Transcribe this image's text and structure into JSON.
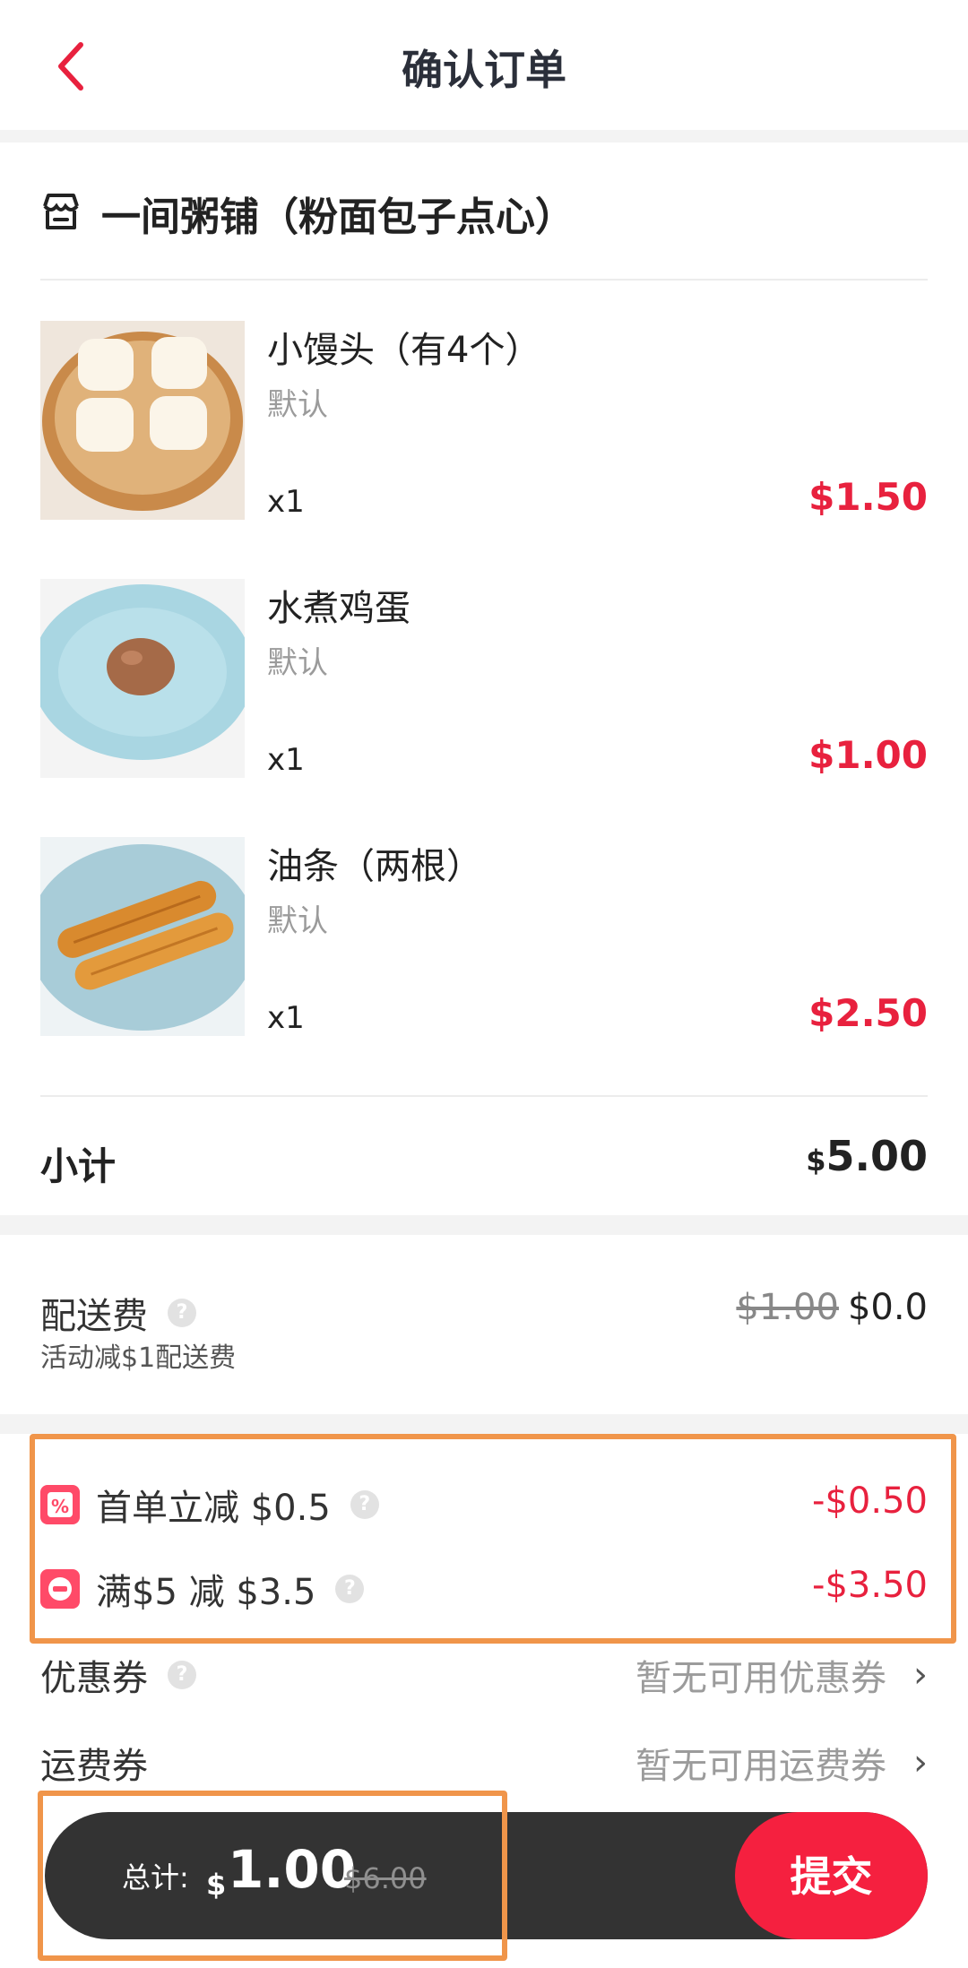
{
  "header": {
    "title": "确认订单"
  },
  "store": {
    "name": "一间粥铺（粉面包子点心）"
  },
  "items": [
    {
      "name": "小馒头（有4个）",
      "spec": "默认",
      "qty": "x1",
      "price": "$1.50"
    },
    {
      "name": "水煮鸡蛋",
      "spec": "默认",
      "qty": "x1",
      "price": "$1.00"
    },
    {
      "name": "油条（两根）",
      "spec": "默认",
      "qty": "x1",
      "price": "$2.50"
    }
  ],
  "subtotal": {
    "label": "小计",
    "currency": "$",
    "value": "5.00"
  },
  "delivery": {
    "label": "配送费",
    "old_fee": "$1.00",
    "fee": "$0.0",
    "note": "活动减$1配送费"
  },
  "discounts": [
    {
      "label": "首单立减 $0.5",
      "value": "-$0.50",
      "icon": "percent-tag-icon"
    },
    {
      "label": "满$5 减 $3.5",
      "value": "-$3.50",
      "icon": "minus-badge-icon"
    }
  ],
  "coupons": [
    {
      "label": "优惠券",
      "value": "暂无可用优惠券"
    },
    {
      "label": "运费券",
      "value": "暂无可用运费券"
    }
  ],
  "footer": {
    "total_label": "总计:",
    "currency": "$",
    "total": "1.00",
    "original_total": "$6.00",
    "submit_label": "提交"
  },
  "colors": {
    "accent": "#f5203f",
    "price_red": "#e8213e",
    "highlight_box": "#f0954a",
    "bar": "#333333"
  }
}
